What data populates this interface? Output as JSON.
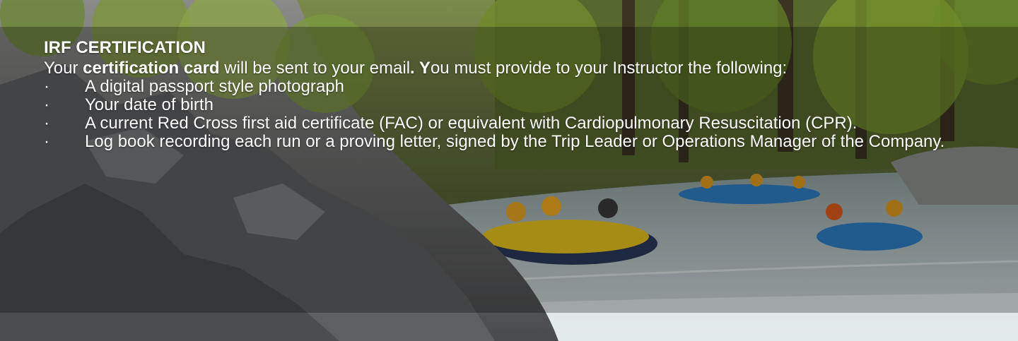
{
  "banner": {
    "title": "IRF CERTIFICATION",
    "intro": {
      "t1": "Your ",
      "b1": "certification card",
      "t2": " will be sent to your email",
      "b2": ". Y",
      "t3": "ou must provide to your Instructor the following:"
    },
    "bullet": "·",
    "requirements": [
      "A digital passport style photograph",
      "Your date of birth",
      "A current Red Cross first aid certificate (FAC) or equivalent with Cardiopulmonary Resuscitation (CPR).",
      "Log book recording each run or a proving letter, signed by the Trip Leader or Operations Manager of the Company."
    ]
  },
  "colors": {
    "text": "#ffffff",
    "raft_yellow": "#e7c31c",
    "raft_blue": "#2f7fc4",
    "water": "#c9d4d8",
    "forest": "#4f6a2c",
    "rock": "#6b6d70"
  },
  "icons": {
    "bullet": "middle-dot-bullet-icon"
  }
}
